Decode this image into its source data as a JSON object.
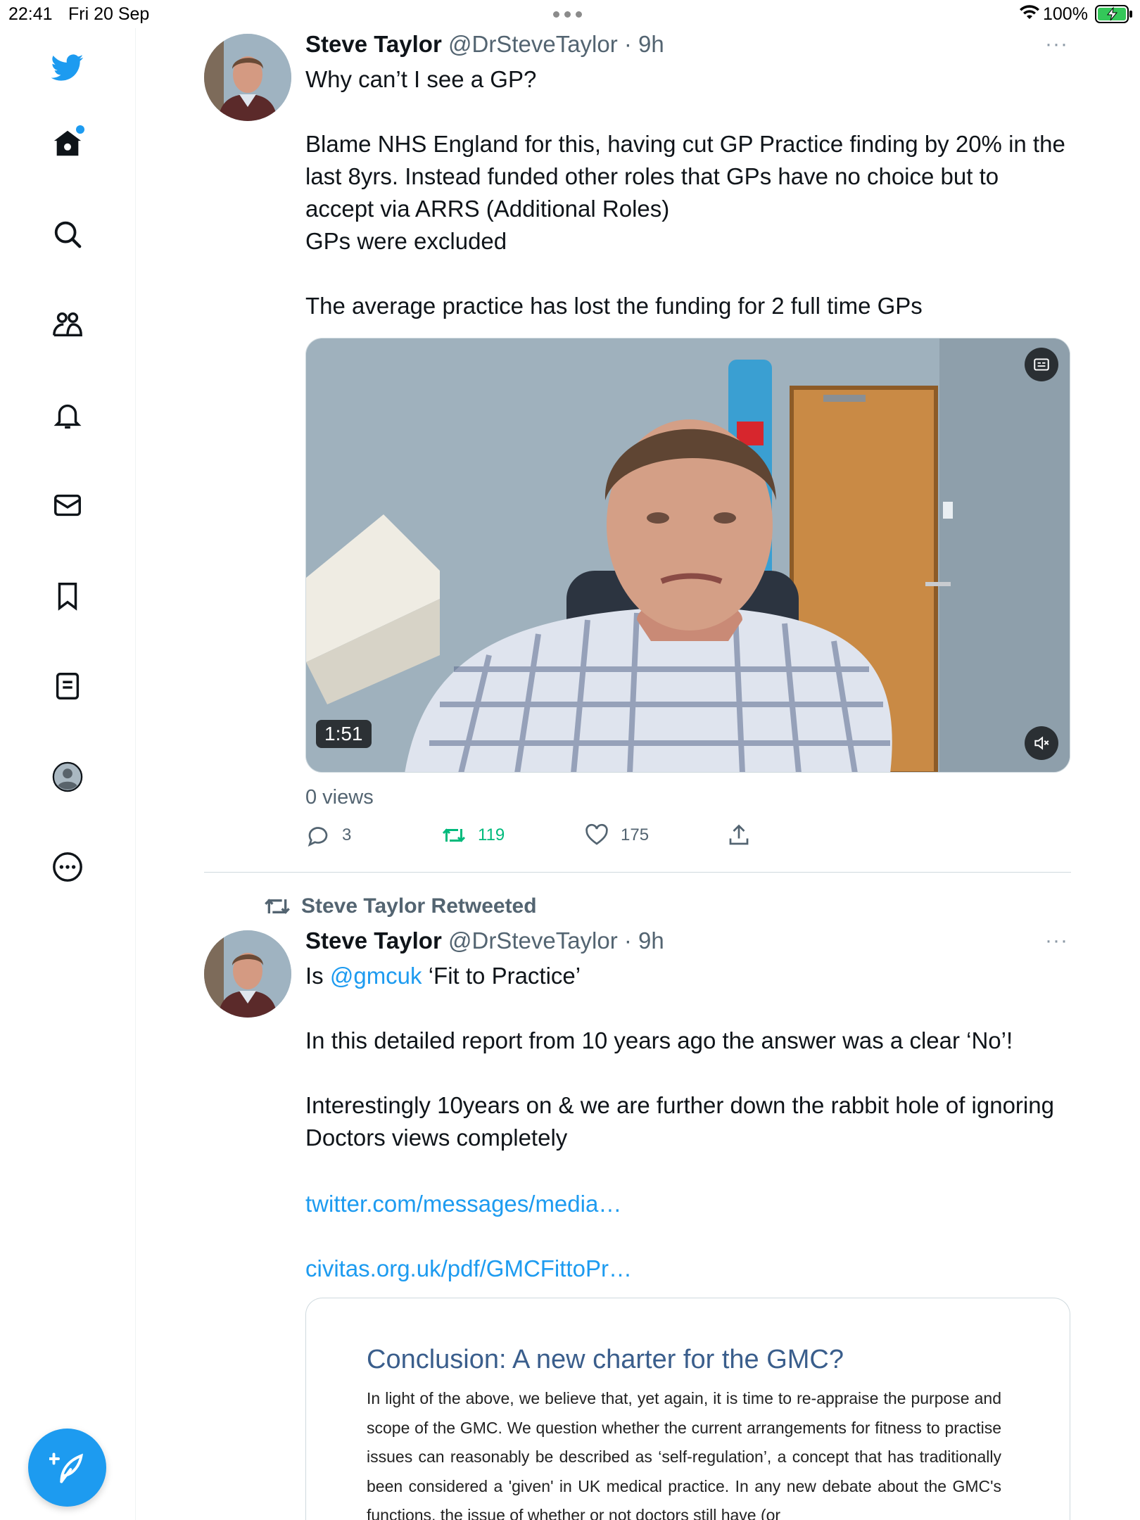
{
  "status_bar": {
    "time": "22:41",
    "date": "Fri 20 Sep",
    "battery": "100%"
  },
  "sidebar": {
    "items": [
      {
        "name": "twitter-logo-icon"
      },
      {
        "name": "home-icon"
      },
      {
        "name": "search-icon"
      },
      {
        "name": "communities-icon"
      },
      {
        "name": "notifications-icon"
      },
      {
        "name": "messages-icon"
      },
      {
        "name": "bookmarks-icon"
      },
      {
        "name": "lists-icon"
      },
      {
        "name": "profile-icon"
      },
      {
        "name": "more-icon"
      }
    ],
    "compose": {
      "name": "compose-tweet-icon"
    }
  },
  "tweets": [
    {
      "name": "Steve Taylor",
      "handle": "@DrSteveTaylor",
      "time": "· 9h",
      "more": "···",
      "body": "Why can’t I see a GP?\n\nBlame NHS England for this, having cut GP Practice finding by 20% in the last 8yrs. Instead funded other roles that GPs have no choice but to accept via ARRS (Additional Roles)\nGPs were excluded\n\nThe average practice has lost the funding for 2 full time GPs",
      "video": {
        "duration": "1:51"
      },
      "views": "0 views",
      "replies": "3",
      "retweets": "119",
      "likes": "175"
    },
    {
      "retweet_banner": "Steve Taylor Retweeted",
      "name": "Steve Taylor",
      "handle": "@DrSteveTaylor",
      "time": "· 9h",
      "more": "···",
      "body_intro": "Is ",
      "mention": "@gmcuk",
      "body_after_mention": " ‘Fit to Practice’\n\nIn this detailed report from 10 years ago the answer was a clear ‘No’!\n\nInterestingly 10years on & we are further down the rabbit hole of ignoring Doctors views completely",
      "link1": "twitter.com/messages/media…",
      "link2": "civitas.org.uk/pdf/GMCFittoPr…",
      "card": {
        "title": "Conclusion: A new charter for the GMC?",
        "text": "In light of the above, we believe that, yet again, it is time to re-appraise the purpose and scope of the GMC. We question whether the current arrangements for fitness to practise issues can reasonably be described as ‘self-regulation’, a concept that has traditionally been considered a 'given' in UK medical practice. In any new debate about the GMC's functions, the issue of whether or not doctors still have (or"
      }
    }
  ],
  "colors": {
    "accent": "#1d9bf0",
    "retweet_green": "#00ba7c",
    "secondary_text": "#536471"
  }
}
